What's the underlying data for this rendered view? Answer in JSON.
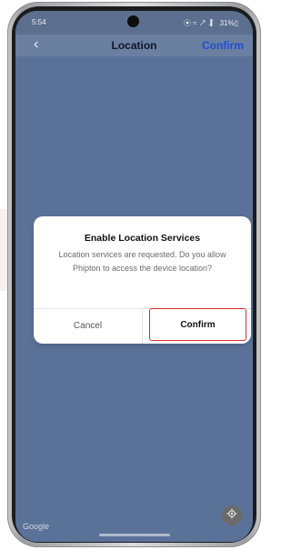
{
  "status_bar": {
    "time": "5:54",
    "indicators": "⦿ ≈ ↗ .▎ 31%▯"
  },
  "app_bar": {
    "back_icon": "chevron-left-icon",
    "title": "Location",
    "confirm_label": "Confirm",
    "confirm_color": "#1d4fd6"
  },
  "map": {
    "background_color": "#5b7298",
    "attribution": "Google",
    "locate_icon": "locate-icon"
  },
  "dialog": {
    "title": "Enable Location Services",
    "message": "Location services are requested. Do you allow Phipton to access the device location?",
    "cancel_label": "Cancel",
    "confirm_label": "Confirm",
    "highlight_color": "#d92d2d"
  }
}
